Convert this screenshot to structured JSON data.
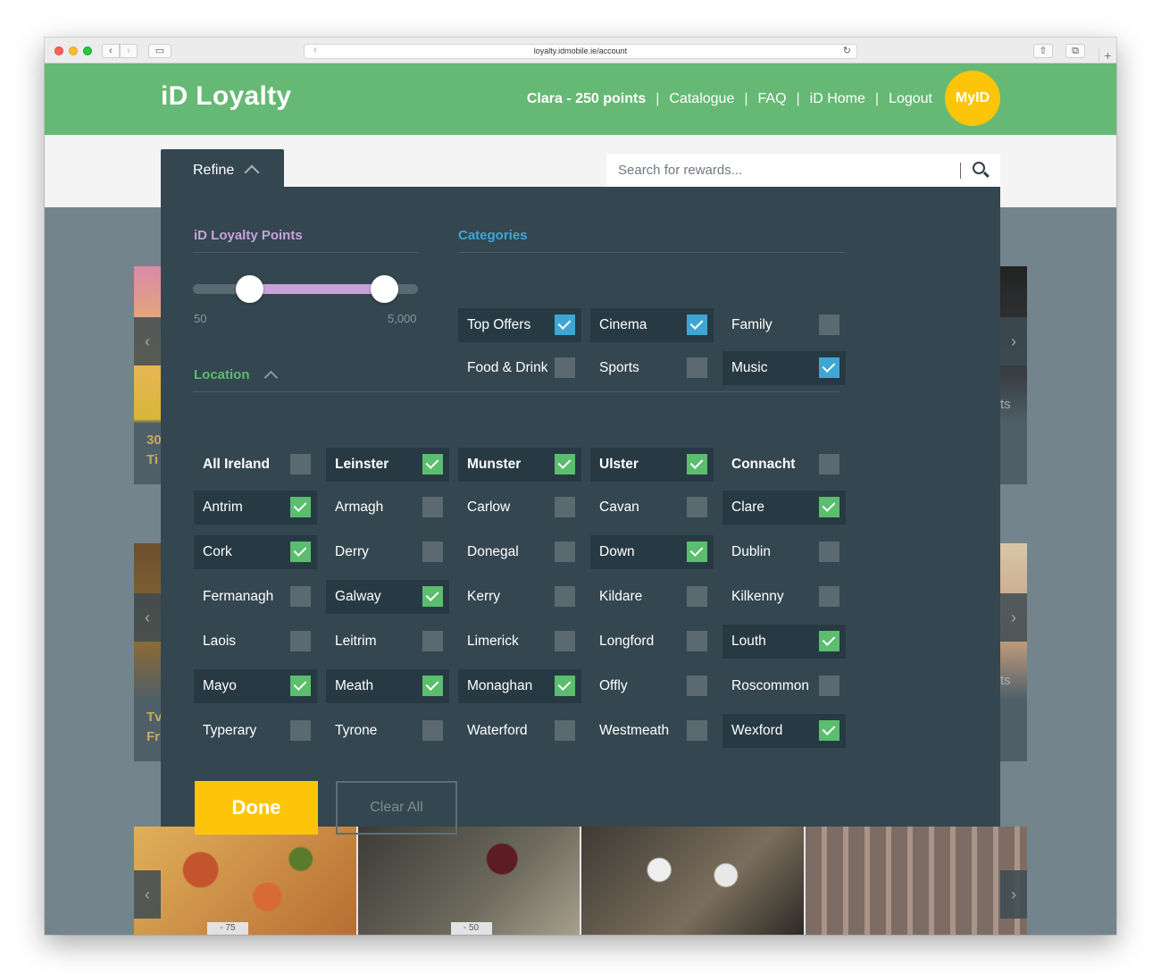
{
  "browser": {
    "url": "loyalty.idmobile.ie/account",
    "back_glyph": "‹",
    "forward_glyph": "›",
    "sidebar_glyph": "▭",
    "reload_glyph": "↻",
    "share_glyph": "⇧",
    "tabs_glyph": "⧉",
    "plus_glyph": "+"
  },
  "header": {
    "logo": "iD Loyalty",
    "nav": {
      "user": "Clara - 250 points",
      "catalogue": "Catalogue",
      "faq": "FAQ",
      "id_home": "iD Home",
      "logout": "Logout"
    },
    "separator": "|",
    "myid": "MyID",
    "colors": {
      "header_bg": "#66b974",
      "myid_bg": "#fdc50a"
    }
  },
  "refine": {
    "tab_label": "Refine"
  },
  "search": {
    "placeholder": "Search for rewards..."
  },
  "points": {
    "title": "iD Loyalty Points",
    "min_label": "50",
    "max_label": "5,000",
    "range_min": 50,
    "range_max": 5000,
    "selected_low_fraction": 0.25,
    "selected_high_fraction": 0.85,
    "accent": "#c7a2d9"
  },
  "categories": {
    "title": "Categories",
    "accent": "#3fa6d3",
    "items": [
      {
        "label": "Top Offers",
        "checked": true
      },
      {
        "label": "Cinema",
        "checked": true
      },
      {
        "label": "Family",
        "checked": false
      },
      {
        "label": "Food & Drink",
        "checked": false
      },
      {
        "label": "Sports",
        "checked": false
      },
      {
        "label": "Music",
        "checked": true
      }
    ]
  },
  "location": {
    "title": "Location",
    "accent": "#5bbd6e",
    "provinces": [
      {
        "label": "All Ireland",
        "checked": false
      },
      {
        "label": "Leinster",
        "checked": true
      },
      {
        "label": "Munster",
        "checked": true
      },
      {
        "label": "Ulster",
        "checked": true
      },
      {
        "label": "Connacht",
        "checked": false
      }
    ],
    "counties": [
      {
        "label": "Antrim",
        "checked": true
      },
      {
        "label": "Armagh",
        "checked": false
      },
      {
        "label": "Carlow",
        "checked": false
      },
      {
        "label": "Cavan",
        "checked": false
      },
      {
        "label": "Clare",
        "checked": true
      },
      {
        "label": "Cork",
        "checked": true
      },
      {
        "label": "Derry",
        "checked": false
      },
      {
        "label": "Donegal",
        "checked": false
      },
      {
        "label": "Down",
        "checked": true
      },
      {
        "label": "Dublin",
        "checked": false
      },
      {
        "label": "Fermanagh",
        "checked": false
      },
      {
        "label": "Galway",
        "checked": true
      },
      {
        "label": "Kerry",
        "checked": false
      },
      {
        "label": "Kildare",
        "checked": false
      },
      {
        "label": "Kilkenny",
        "checked": false
      },
      {
        "label": "Laois",
        "checked": false
      },
      {
        "label": "Leitrim",
        "checked": false
      },
      {
        "label": "Limerick",
        "checked": false
      },
      {
        "label": "Longford",
        "checked": false
      },
      {
        "label": "Louth",
        "checked": true
      },
      {
        "label": "Mayo",
        "checked": true
      },
      {
        "label": "Meath",
        "checked": true
      },
      {
        "label": "Monaghan",
        "checked": true
      },
      {
        "label": "Offly",
        "checked": false
      },
      {
        "label": "Roscommon",
        "checked": false
      },
      {
        "label": "Typerary",
        "checked": false
      },
      {
        "label": "Tyrone",
        "checked": false
      },
      {
        "label": "Waterford",
        "checked": false
      },
      {
        "label": "Westmeath",
        "checked": false
      },
      {
        "label": "Wexford",
        "checked": true
      }
    ]
  },
  "actions": {
    "done": "Done",
    "clear_all": "Clear All"
  },
  "background": {
    "row1_left_text": "30\nTi",
    "row1_right_text": "ts",
    "row2_left_text": "Tv\nFr",
    "row2_right_text": "ts",
    "arrow_left": "‹",
    "arrow_right": "›",
    "price_1": "- 75",
    "price_2": "- 50"
  }
}
